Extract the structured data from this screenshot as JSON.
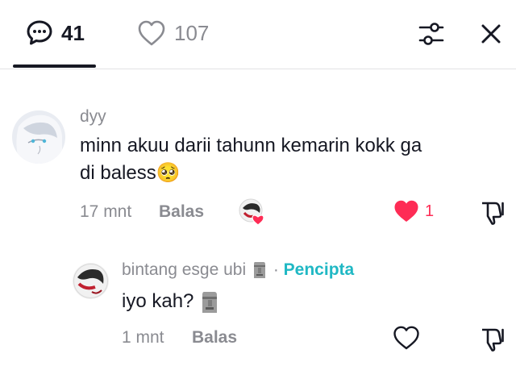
{
  "header": {
    "comments_count": "41",
    "likes_count": "107"
  },
  "comments": [
    {
      "username": "dyy",
      "text_line1": "minn akuu darii tahunn kemarin kokk ga",
      "text_line2": "di baless",
      "emoji": "🥺",
      "time": "17 mnt",
      "reply_label": "Balas",
      "like_count": "1",
      "liked": true
    },
    {
      "username": "bintang esge ubi",
      "creator_label": "Pencipta",
      "separator": "·",
      "text": "iyo kah?",
      "time": "1 mnt",
      "reply_label": "Balas",
      "liked": false
    }
  ],
  "colors": {
    "text": "#161823",
    "muted": "#8a8b91",
    "like": "#fe2c55",
    "creator": "#20b8c4"
  },
  "icons": [
    "comment-bubble-icon",
    "heart-outline-icon",
    "filter-icon",
    "close-icon",
    "heart-filled-icon",
    "dislike-icon",
    "moai-emoji-icon"
  ]
}
